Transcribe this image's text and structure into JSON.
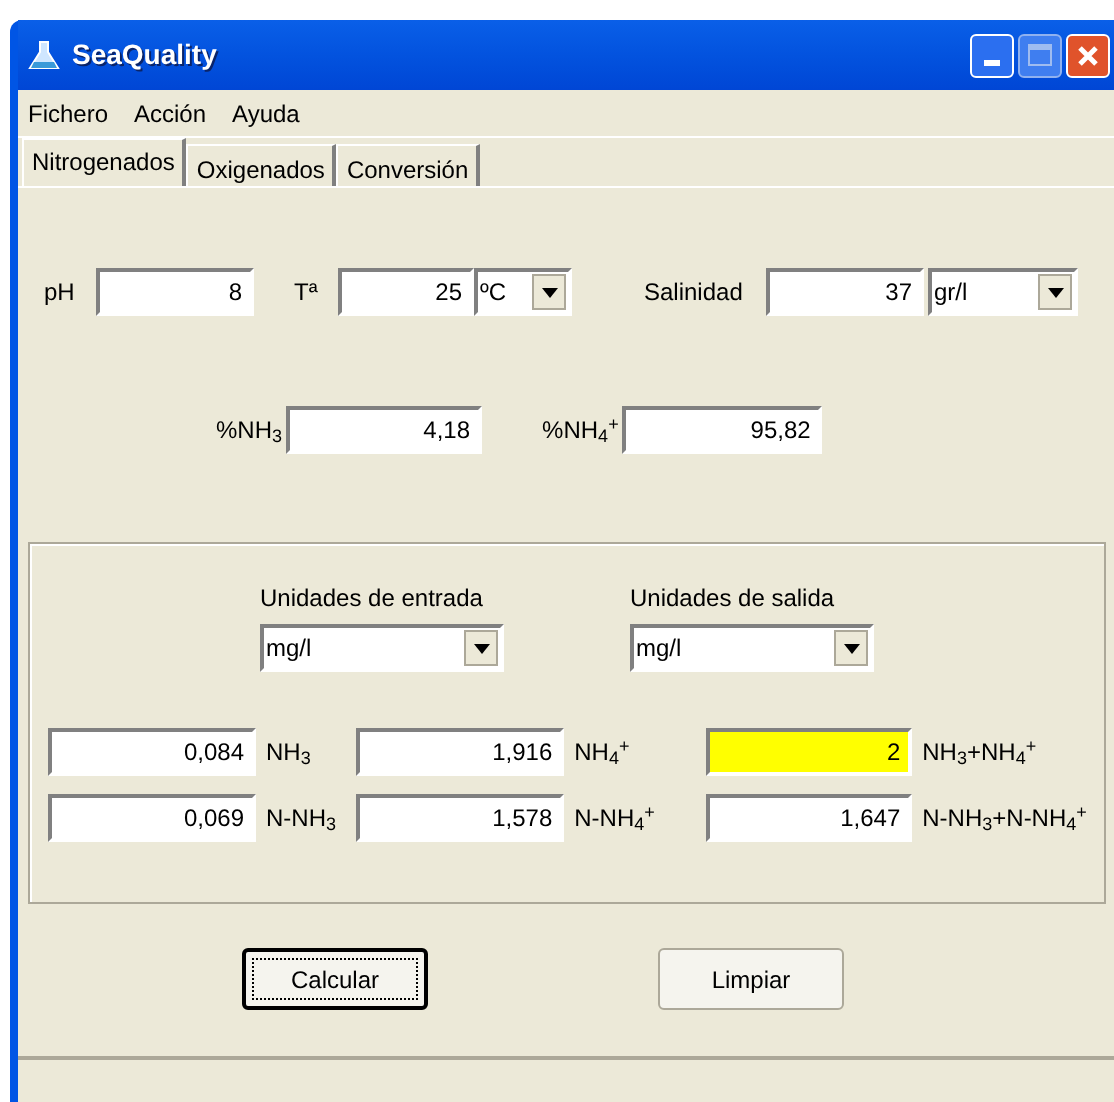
{
  "window": {
    "title": "SeaQuality"
  },
  "menu": [
    "Fichero",
    "Acción",
    "Ayuda"
  ],
  "tabs": [
    {
      "label": "Nitrogenados",
      "selected": true
    },
    {
      "label": "Oxigenados",
      "selected": false
    },
    {
      "label": "Conversión",
      "selected": false
    }
  ],
  "conditions": [
    {
      "label": "pH",
      "value": "8"
    },
    {
      "label": "Tª",
      "value": "25",
      "unit": "ºC"
    },
    {
      "label": "Salinidad",
      "value": "37",
      "unit": "gr/l"
    }
  ],
  "percentages": [
    {
      "label": "%NH$_{3}$",
      "value": "4,18"
    },
    {
      "label": "%NH$_{4}$$^{+}$",
      "value": "95,82"
    }
  ],
  "units": [
    {
      "label": "Unidades de entrada",
      "value": "mg/l"
    },
    {
      "label": "Unidades de salida",
      "value": "mg/l"
    }
  ],
  "conversions": [
    [
      {
        "value": "0,084",
        "label": "NH$_{3}$",
        "highlighted": false
      },
      {
        "value": "1,916",
        "label": "NH$_{4}$$^{+}$",
        "highlighted": false
      },
      {
        "value": "2",
        "label": "NH$_{3}$+NH$_{4}$$^{+}$",
        "highlighted": true
      }
    ],
    [
      {
        "value": "0,069",
        "label": "N-NH$_{3}$",
        "highlighted": false
      },
      {
        "value": "1,578",
        "label": "N-NH$_{4}$$^{+}$",
        "highlighted": false
      },
      {
        "value": "1,647",
        "label": "N-NH$_{3}$+N-NH$_{4}$$^{+}$",
        "highlighted": false
      }
    ]
  ],
  "buttons": [
    {
      "label": "Calcular",
      "focused": true
    },
    {
      "label": "Limpiar",
      "focused": false
    }
  ]
}
